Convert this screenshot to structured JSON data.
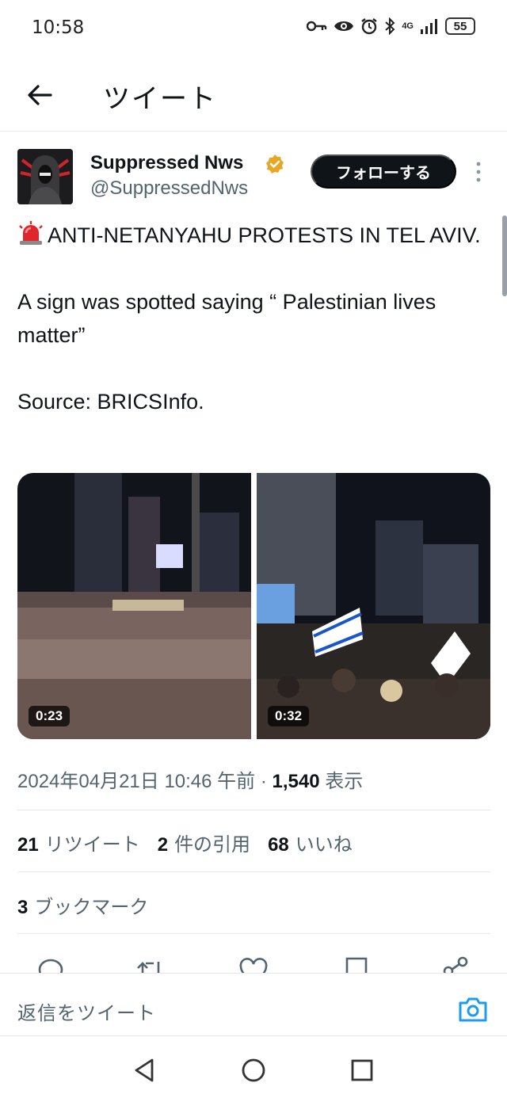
{
  "status_bar": {
    "time": "10:58",
    "network": "4G",
    "battery": "55"
  },
  "header": {
    "title": "ツイート"
  },
  "tweet": {
    "display_name": "Suppressed Nws",
    "handle": "@SuppressedNws",
    "follow_label": "フォローする",
    "text_line1": "ANTI-NETANYAHU PROTESTS IN TEL AVIV.",
    "text_line2": "A sign was spotted saying “ Palestinian lives matter”",
    "text_line3": "Source: BRICSInfo.",
    "media": [
      {
        "duration": "0:23"
      },
      {
        "duration": "0:32"
      }
    ],
    "timestamp": "2024年04月21日 10:46 午前",
    "separator": " · ",
    "views_count": "1,540",
    "views_label": "表示"
  },
  "stats": {
    "retweets_count": "21",
    "retweets_label": "リツイート",
    "quotes_count": "2",
    "quotes_label": "件の引用",
    "likes_count": "68",
    "likes_label": "いいね",
    "bookmarks_count": "3",
    "bookmarks_label": "ブックマーク"
  },
  "reply": {
    "placeholder": "返信をツイート"
  },
  "colors": {
    "accent": "#1d9bf0",
    "text_primary": "#0f1419",
    "text_secondary": "#536471",
    "verified_gold": "#e8a624"
  },
  "icons": [
    "back-arrow-icon",
    "verified-badge-icon",
    "more-vertical-icon",
    "siren-icon",
    "reply-icon",
    "retweet-icon",
    "like-icon",
    "bookmark-icon",
    "share-icon",
    "camera-icon",
    "nav-back-icon",
    "nav-home-icon",
    "nav-recents-icon"
  ]
}
